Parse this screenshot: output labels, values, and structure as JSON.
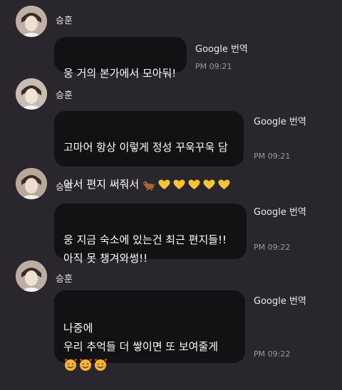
{
  "messages": [
    {
      "sender": "승훈",
      "text": "웅 거의 본가에서 모아둬!",
      "translate_label": "Google 번역",
      "time": "PM 09:21"
    },
    {
      "sender": "승훈",
      "text_line1": "고마어 항상 이렇게 정성 꾸욱꾸욱 담",
      "text_line2": "아서 편지 써줘서",
      "emojis": [
        "dog-icon",
        "yellow-heart-icon",
        "yellow-heart-icon",
        "yellow-heart-icon",
        "yellow-heart-icon",
        "yellow-heart-icon"
      ],
      "translate_label": "Google 번역",
      "time": "PM 09:21"
    },
    {
      "sender": "승훈",
      "text": "웅 지금 숙소에 있는건 최근 편지들!!\n아직 못 챙겨와썽!!",
      "translate_label": "Google 번역",
      "time": "PM 09:22"
    },
    {
      "sender": "승훈",
      "text": "나중에\n우리 추억들 더 쌓이면 또 보여줄게",
      "emojis": [
        "smiling-face-with-hearts-icon",
        "smiling-face-with-hearts-icon",
        "smiling-face-with-hearts-icon"
      ],
      "translate_label": "Google 번역",
      "time": "PM 09:22"
    }
  ],
  "colors": {
    "background": "#29272d",
    "bubble": "#121214",
    "heart": "#f7c436",
    "time": "#9b98a0"
  }
}
